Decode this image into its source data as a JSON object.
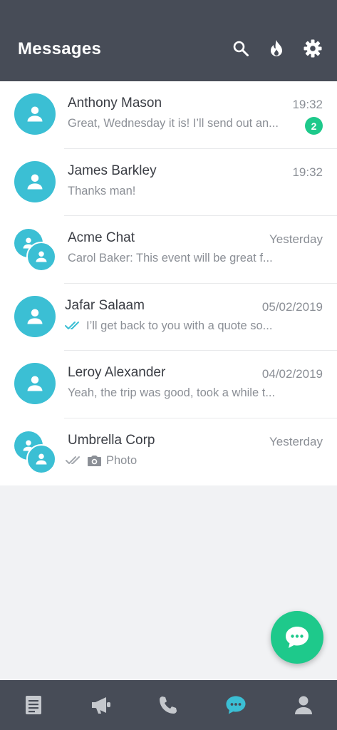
{
  "header": {
    "title": "Messages"
  },
  "colors": {
    "header_bg": "#474c57",
    "accent_teal": "#3bbfd4",
    "accent_green": "#1ec98b"
  },
  "conversations": [
    {
      "name": "Anthony Mason",
      "time": "19:32",
      "preview": "Great, Wednesday it is! I’ll send out an...",
      "unread": "2",
      "avatar": "person-icon"
    },
    {
      "name": "James Barkley",
      "time": "19:32",
      "preview": "Thanks man!",
      "avatar": "person-icon"
    },
    {
      "name": "Acme Chat",
      "time": "Yesterday",
      "preview": "Carol Baker: This event will be great f...",
      "avatar": "group-icon"
    },
    {
      "name": "Jafar Salaam",
      "time": "05/02/2019",
      "preview": "I’ll get back to you with a quote so...",
      "status": "read",
      "avatar": "person-icon"
    },
    {
      "name": "Leroy Alexander",
      "time": "04/02/2019",
      "preview": "Yeah, the trip was good, took a while t...",
      "avatar": "person-icon"
    },
    {
      "name": "Umbrella Corp",
      "time": "Yesterday",
      "preview": "Photo",
      "status": "delivered",
      "attachment": "camera-icon",
      "avatar": "group-icon"
    }
  ],
  "bottom_nav": [
    "document-icon",
    "megaphone-icon",
    "phone-icon",
    "chat-icon",
    "profile-icon"
  ],
  "active_tab": "chat-icon"
}
